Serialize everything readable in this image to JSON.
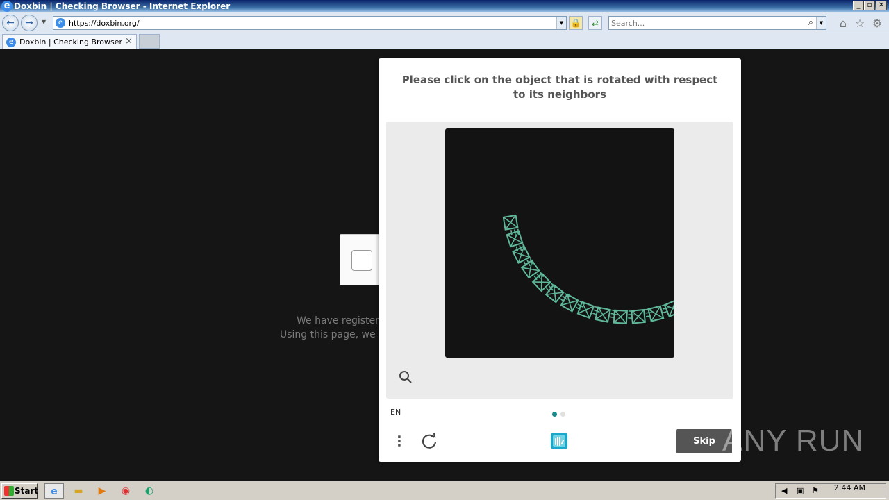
{
  "window": {
    "title": "Doxbin | Checking Browser - Internet Explorer"
  },
  "address_bar": {
    "url": "https://doxbin.org/",
    "search_placeholder": "Search..."
  },
  "tabs": [
    {
      "label": "Doxbin | Checking Browser"
    }
  ],
  "background_page": {
    "line1": "We have registere",
    "line2": "Using this page, we w"
  },
  "captcha": {
    "prompt": "Please click on the object that is rotated with respect to its neighbors",
    "language": "EN",
    "skip_label": "Skip",
    "page_dots": {
      "count": 2,
      "active": 0
    },
    "accent_color": "#1a8a8a",
    "item_color": "#5fb89a",
    "icons": [
      "zoom-icon",
      "menu-icon",
      "refresh-icon",
      "hcaptcha-logo"
    ]
  },
  "watermark": "ANY RUN",
  "taskbar": {
    "start_label": "Start",
    "apps": [
      "internet-explorer-icon",
      "folder-icon",
      "media-player-icon",
      "chrome-icon",
      "edge-icon"
    ],
    "clock": "2:44 AM"
  }
}
